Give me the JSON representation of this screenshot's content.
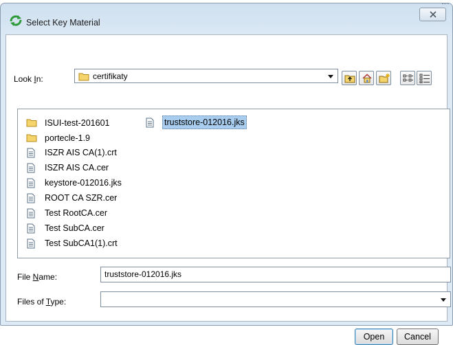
{
  "window": {
    "title": "Select Key Material",
    "close_symbol": "☒"
  },
  "look_in": {
    "label_pre": "Look ",
    "label_u": "I",
    "label_post": "n:",
    "value": "certifikaty"
  },
  "toolbar": {
    "up_folder_icon": "up-folder-icon",
    "home_icon": "home-icon",
    "new_folder_icon": "new-folder-icon",
    "list_view_icon": "list-view-icon",
    "details_view_icon": "details-view-icon"
  },
  "files": [
    {
      "name": "ISUI-test-201601",
      "type": "folder"
    },
    {
      "name": "portecle-1.9",
      "type": "folder"
    },
    {
      "name": "ISZR AIS CA(1).crt",
      "type": "file"
    },
    {
      "name": "ISZR AIS CA.cer",
      "type": "file"
    },
    {
      "name": "keystore-012016.jks",
      "type": "file"
    },
    {
      "name": "ROOT CA SZR.cer",
      "type": "file"
    },
    {
      "name": "Test RootCA.cer",
      "type": "file"
    },
    {
      "name": "Test SubCA.cer",
      "type": "file"
    },
    {
      "name": "Test SubCA1(1).crt",
      "type": "file"
    },
    {
      "name": "truststore-012016.jks",
      "type": "file",
      "selected": true
    }
  ],
  "file_name": {
    "label_pre": "File ",
    "label_u": "N",
    "label_post": "ame:",
    "value": "truststore-012016.jks"
  },
  "files_of_type": {
    "label_pre": "Files of ",
    "label_u": "T",
    "label_post": "ype:",
    "value": ""
  },
  "buttons": {
    "open": "Open",
    "cancel": "Cancel"
  },
  "colors": {
    "selection": "#a8cdee",
    "folder": "#f5d56b"
  }
}
